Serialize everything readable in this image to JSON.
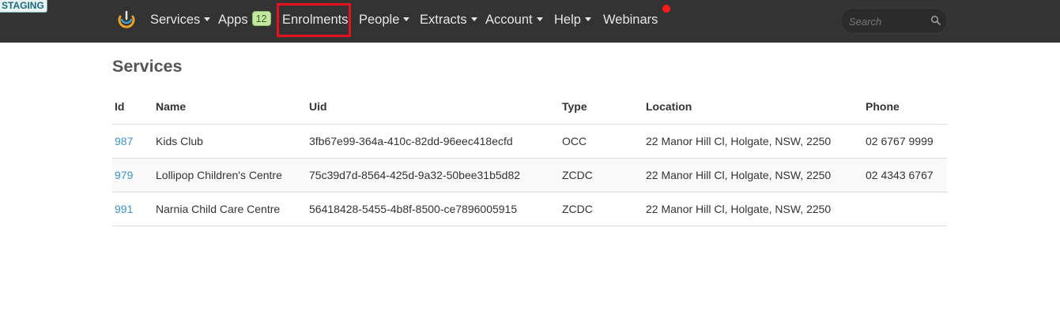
{
  "environment_badge": "STAGING",
  "nav": {
    "items": [
      {
        "label": "Services",
        "dropdown": true
      },
      {
        "label": "Apps",
        "badge": "12"
      },
      {
        "label": "Enrolments",
        "highlighted": true
      },
      {
        "label": "People",
        "dropdown": true
      },
      {
        "label": "Extracts",
        "dropdown": true
      },
      {
        "label": "Account",
        "dropdown": true
      },
      {
        "label": "Help",
        "dropdown": true
      },
      {
        "label": "Webinars",
        "notification": true
      }
    ],
    "search": {
      "placeholder": "Search",
      "value": ""
    }
  },
  "page": {
    "title": "Services"
  },
  "table": {
    "columns": [
      "Id",
      "Name",
      "Uid",
      "Type",
      "Location",
      "Phone"
    ],
    "rows": [
      {
        "id": "987",
        "name": "Kids Club",
        "uid": "3fb67e99-364a-410c-82dd-96eec418ecfd",
        "type": "OCC",
        "location": "22 Manor Hill Cl, Holgate, NSW, 2250",
        "phone": "02 6767 9999"
      },
      {
        "id": "979",
        "name": "Lollipop Children's Centre",
        "uid": "75c39d7d-8564-425d-9a32-50bee31b5d82",
        "type": "ZCDC",
        "location": "22 Manor Hill Cl, Holgate, NSW, 2250",
        "phone": "02 4343 6767"
      },
      {
        "id": "991",
        "name": "Narnia Child Care Centre",
        "uid": "56418428-5455-4b8f-8500-ce7896005915",
        "type": "ZCDC",
        "location": "22 Manor Hill Cl, Holgate, NSW, 2250",
        "phone": ""
      }
    ]
  },
  "colors": {
    "navbar_bg": "#333333",
    "link": "#3a95c9",
    "highlight_box": "#e5121e",
    "notification_dot": "#ff1a1a",
    "apps_badge_bg": "#c4e7a3"
  },
  "icons": {
    "logo": "brand-logo-icon",
    "search": "search-icon",
    "dropdown": "caret-down-icon"
  }
}
